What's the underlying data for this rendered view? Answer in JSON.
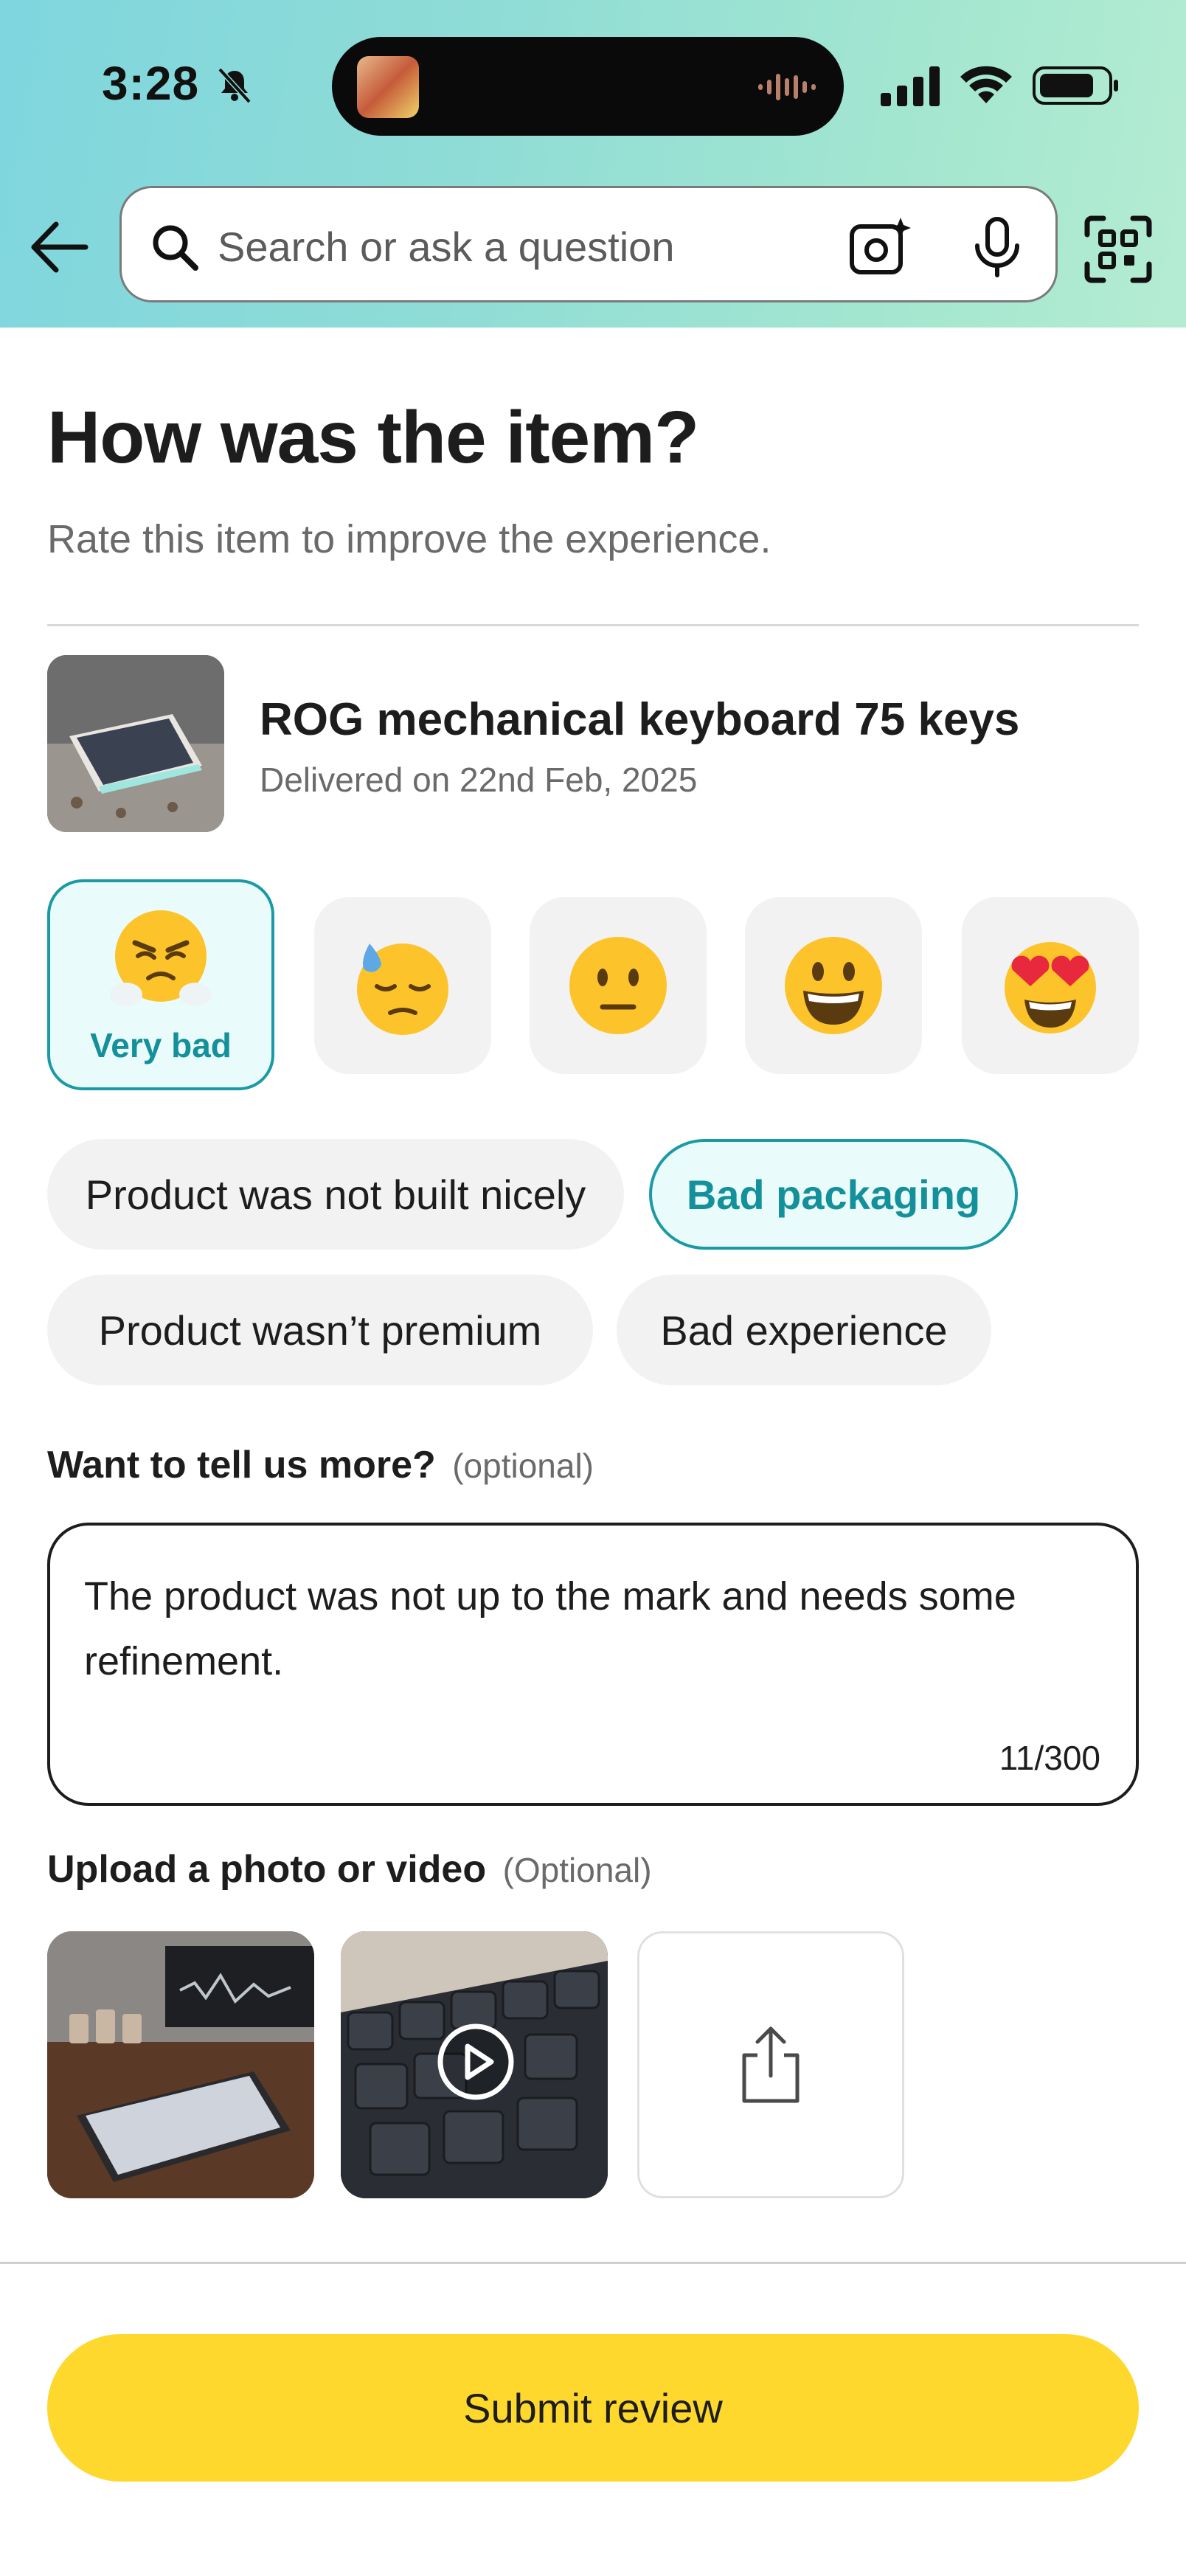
{
  "status_bar": {
    "time": "3:28"
  },
  "header": {
    "search_placeholder": "Search or ask a question",
    "accent_gradient": [
      "#7fd6de",
      "#b4ecd2"
    ]
  },
  "review": {
    "title": "How was the item?",
    "subtitle": "Rate this item to improve the experience.",
    "product": {
      "name": "ROG mechanical keyboard 75 keys",
      "delivery": "Delivered on 22nd Feb, 2025"
    },
    "ratings": [
      {
        "label": "Very bad",
        "emoji": "angry-face",
        "selected": true
      },
      {
        "label": "",
        "emoji": "downcast-sweat-face",
        "selected": false
      },
      {
        "label": "",
        "emoji": "neutral-face",
        "selected": false
      },
      {
        "label": "",
        "emoji": "grinning-face",
        "selected": false
      },
      {
        "label": "",
        "emoji": "heart-eyes-face",
        "selected": false
      }
    ],
    "tags": [
      {
        "label": "Product was not built nicely",
        "selected": false
      },
      {
        "label": "Bad packaging",
        "selected": true
      },
      {
        "label": "Product wasn’t premium",
        "selected": false
      },
      {
        "label": "Bad experience",
        "selected": false
      }
    ],
    "feedback": {
      "label": "Want to tell us more?",
      "optional": "(optional)",
      "text": "The product was not up to the mark and needs some refinement.",
      "char_count": "11/300"
    },
    "upload": {
      "label": "Upload a photo or video",
      "optional": "(Optional)"
    },
    "submit_label": "Submit review",
    "accent_color": "#1a9aa5",
    "submit_color": "#fed82d"
  }
}
